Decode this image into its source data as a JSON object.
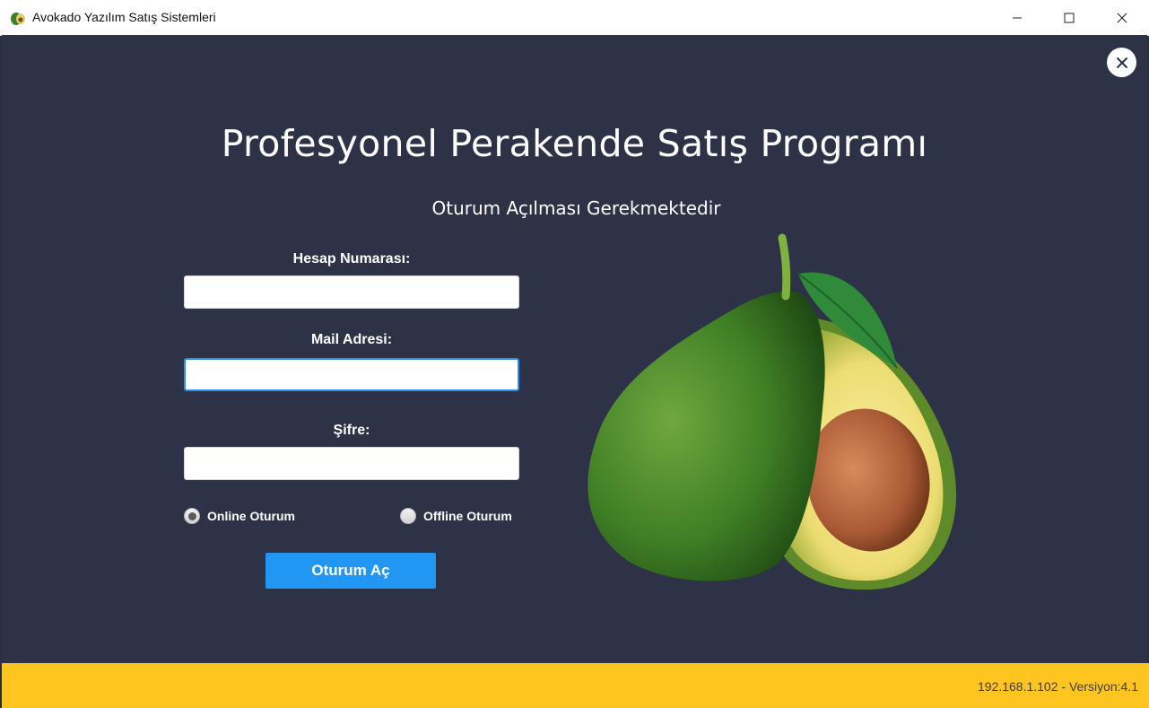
{
  "window": {
    "title": "Avokado Yazılım Satış Sistemleri",
    "app_icon": "avocado-icon",
    "controls": [
      "minimize-icon",
      "maximize-icon",
      "close-icon"
    ]
  },
  "dialog_close_icon": "close-icon",
  "header": {
    "title": "Profesyonel Perakende Satış Programı",
    "subtitle": "Oturum Açılması Gerekmektedir"
  },
  "form": {
    "account_label": "Hesap Numarası:",
    "account_value": "",
    "mail_label": "Mail Adresi:",
    "mail_value": "",
    "password_label": "Şifre:",
    "password_value": "",
    "mode_options": [
      {
        "label": "Online Oturum",
        "selected": true
      },
      {
        "label": "Offline Oturum",
        "selected": false
      }
    ],
    "submit_label": "Oturum Aç"
  },
  "footer": {
    "status": "192.168.1.102 - Versiyon:4.1"
  },
  "colors": {
    "background": "#2e3247",
    "accent": "#2196f3",
    "footer": "#fec521",
    "focus_border": "#2b8ff0"
  }
}
